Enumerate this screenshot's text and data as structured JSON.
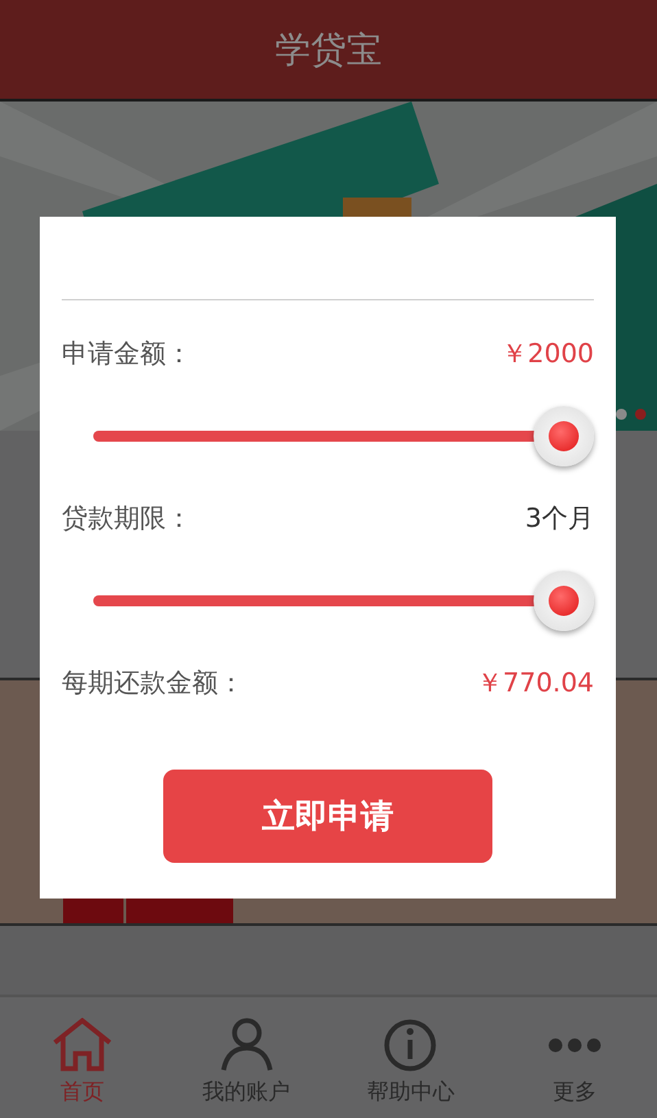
{
  "header": {
    "title": "学贷宝"
  },
  "banner": {
    "kind": "picture",
    "dots": [
      {
        "selected": false
      },
      {
        "selected": true
      }
    ]
  },
  "dialog": {
    "rows": [
      {
        "kind": "value",
        "label": "申请金额：",
        "value": "￥2000",
        "accent": true
      },
      {
        "kind": "slider",
        "level": 1
      },
      {
        "kind": "value",
        "label": "贷款期限：",
        "value": "3个月",
        "accent": false
      },
      {
        "kind": "slider",
        "level": 1
      },
      {
        "kind": "value",
        "label": "每期还款金额：",
        "value": "￥770.04",
        "accent": true
      }
    ],
    "button": "立即申请"
  },
  "tab_bar": [
    {
      "label": "首页",
      "kind": "home",
      "selected": true
    },
    {
      "label": "我的账户",
      "kind": "person",
      "selected": false
    },
    {
      "label": "帮助中心",
      "kind": "info",
      "selected": false
    },
    {
      "label": "更多",
      "kind": "more",
      "selected": false
    }
  ]
}
